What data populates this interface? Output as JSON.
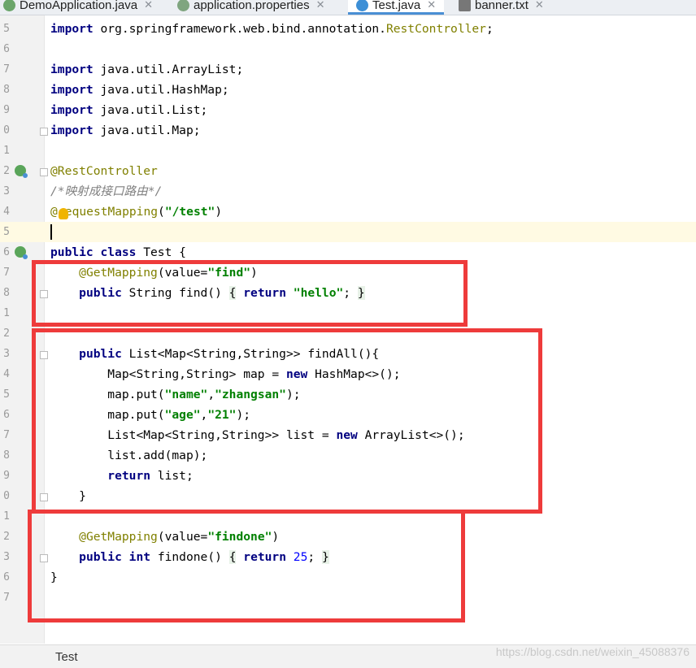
{
  "tabs": [
    {
      "label": "DemoApplication.java",
      "icon": "spring-boot-icon",
      "active": false
    },
    {
      "label": "application.properties",
      "icon": "properties-file-icon",
      "active": false
    },
    {
      "label": "Test.java",
      "icon": "java-class-icon",
      "active": true
    },
    {
      "label": "banner.txt",
      "icon": "text-file-icon",
      "active": false
    }
  ],
  "line_numbers": [
    "5",
    "6",
    "7",
    "8",
    "9",
    "0",
    "1",
    "2",
    "3",
    "4",
    "5",
    "6",
    "7",
    "8",
    "1",
    "2",
    "3",
    "4",
    "5",
    "6",
    "7",
    "8",
    "9",
    "0",
    "1",
    "2",
    "3",
    "6",
    "7"
  ],
  "code": {
    "imp_rc_kw": "import",
    "imp_rc_pkg": " org.springframework.web.bind.annotation.",
    "imp_rc_cls": "RestController",
    "imp_rc_end": ";",
    "imp_kw": "import",
    "imp_arraylist": " java.util.ArrayList;",
    "imp_hashmap": " java.util.HashMap;",
    "imp_list": " java.util.List;",
    "imp_map": " java.util.Map;",
    "ann_restcontroller": "@RestController",
    "comment": "/*映射成接口路由*/",
    "ann_reqmap_at": "@",
    "ann_reqmap_rest": "equestMapping",
    "paren_open": "(",
    "paren_close": ")",
    "str_test": "\"/test\"",
    "kw_public": "public",
    "kw_class": "class",
    "class_name": " Test {",
    "ann_getmapping": "@GetMapping",
    "value_eq": "(value=",
    "str_find": "\"find\"",
    "kw_string_type": " String find() ",
    "brace_open": "{",
    "brace_close": "}",
    "kw_return": "return",
    "str_hello": "\"hello\"",
    "semicolon": ";",
    "list_sig": " List<Map<String,String>> findAll(){",
    "map_decl": "Map<String,String> map = ",
    "kw_new": "new",
    "new_hashmap": " HashMap<>();",
    "map_put": "map.put(",
    "str_name": "\"name\"",
    "comma": ",",
    "str_zhangsan": "\"zhangsan\"",
    "put_end": ");",
    "str_age": "\"age\"",
    "str_21": "\"21\"",
    "list_decl": "List<Map<String,String>> list = ",
    "new_arraylist": " ArrayList<>();",
    "list_add": "list.add(map);",
    "return_list": " list;",
    "str_findone": "\"findone\"",
    "kw_int": "int",
    "findone_sig": " findone() ",
    "num_25": "25",
    "class_close": "}"
  },
  "status": {
    "label": "Test",
    "watermark": "https://blog.csdn.net/weixin_45088376"
  },
  "colors": {
    "annotation_box": "#ee3b3b",
    "keyword": "#000080",
    "string": "#008000",
    "annotation": "#808000"
  }
}
